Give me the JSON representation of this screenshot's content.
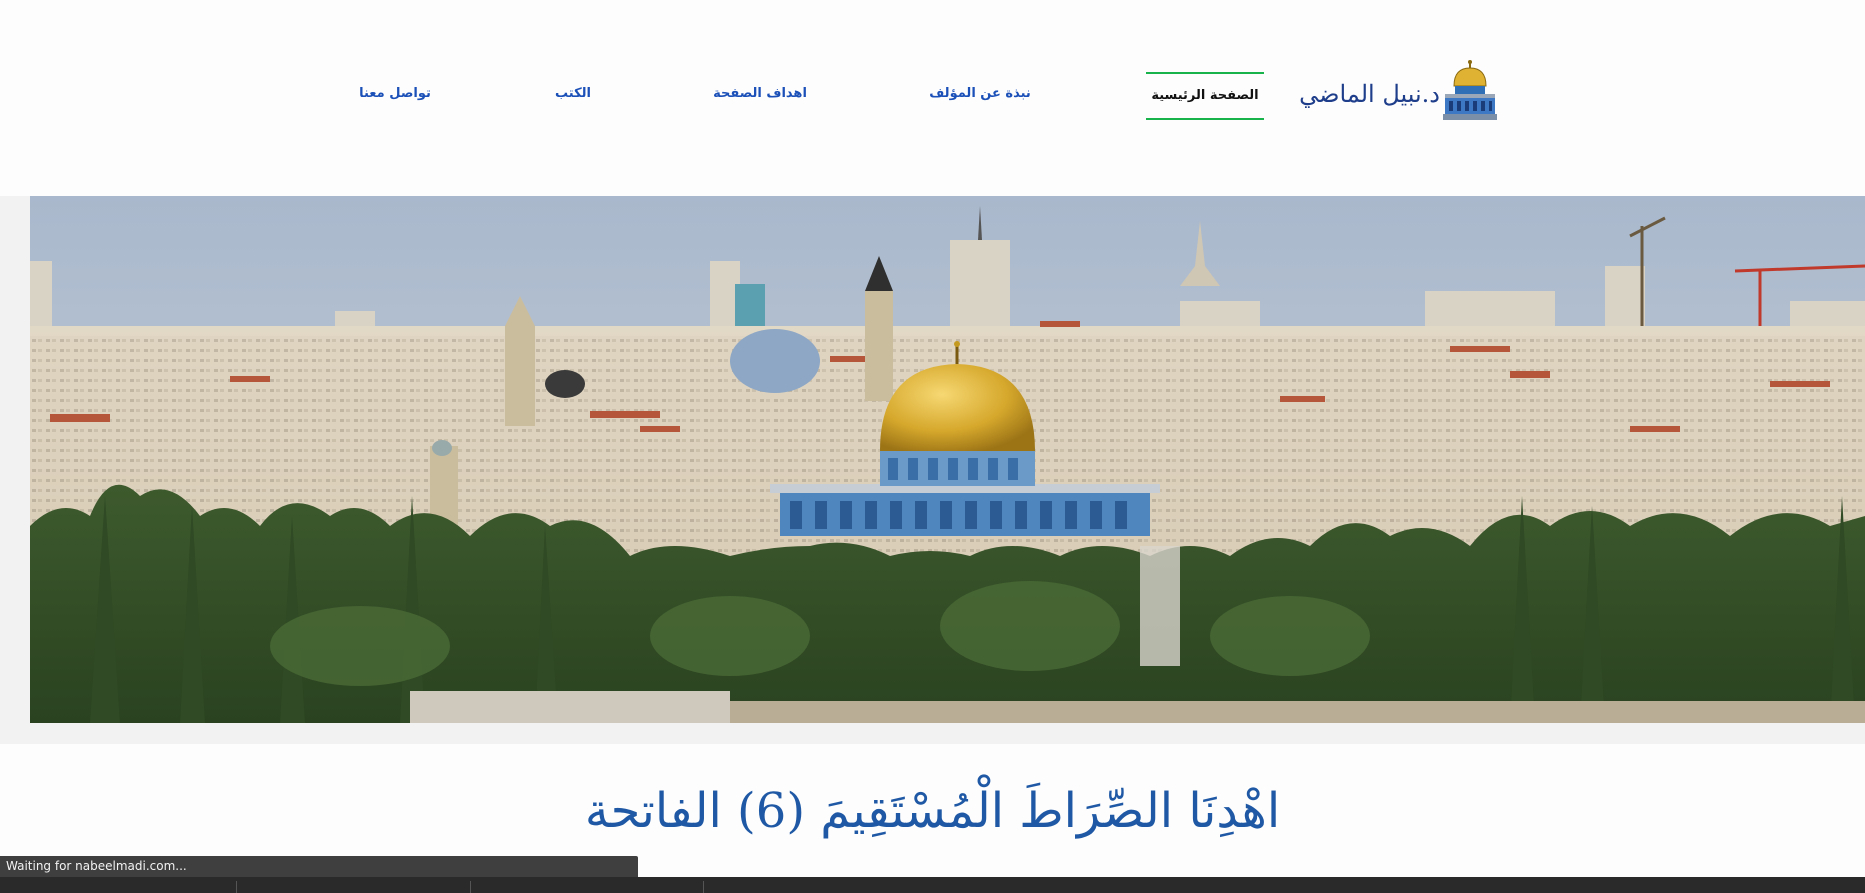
{
  "brand": {
    "name": "د.نبيل الماضي",
    "logo_icon": "dome-of-the-rock-icon"
  },
  "nav": {
    "items": [
      {
        "label": "الصفحة الرئيسية",
        "active": true
      },
      {
        "label": "نبذة عن المؤلف",
        "active": false
      },
      {
        "label": "اهداف الصفحة",
        "active": false
      },
      {
        "label": "الكتب",
        "active": false
      },
      {
        "label": "تواصل معنا",
        "active": false
      }
    ],
    "link_color": "#1b50b8",
    "active_underline_color": "#19b34b"
  },
  "hero": {
    "subject": "jerusalem-panorama-image"
  },
  "verse": {
    "text": "اهْدِنَا الصِّرَاطَ الْمُسْتَقِيمَ (6) الفاتحة"
  },
  "status": {
    "text": "Waiting for nabeelmadi.com..."
  },
  "colors": {
    "accent_blue": "#1f59a5",
    "sky": "#b9c7d8",
    "dome_gold": "#d4a42a"
  }
}
